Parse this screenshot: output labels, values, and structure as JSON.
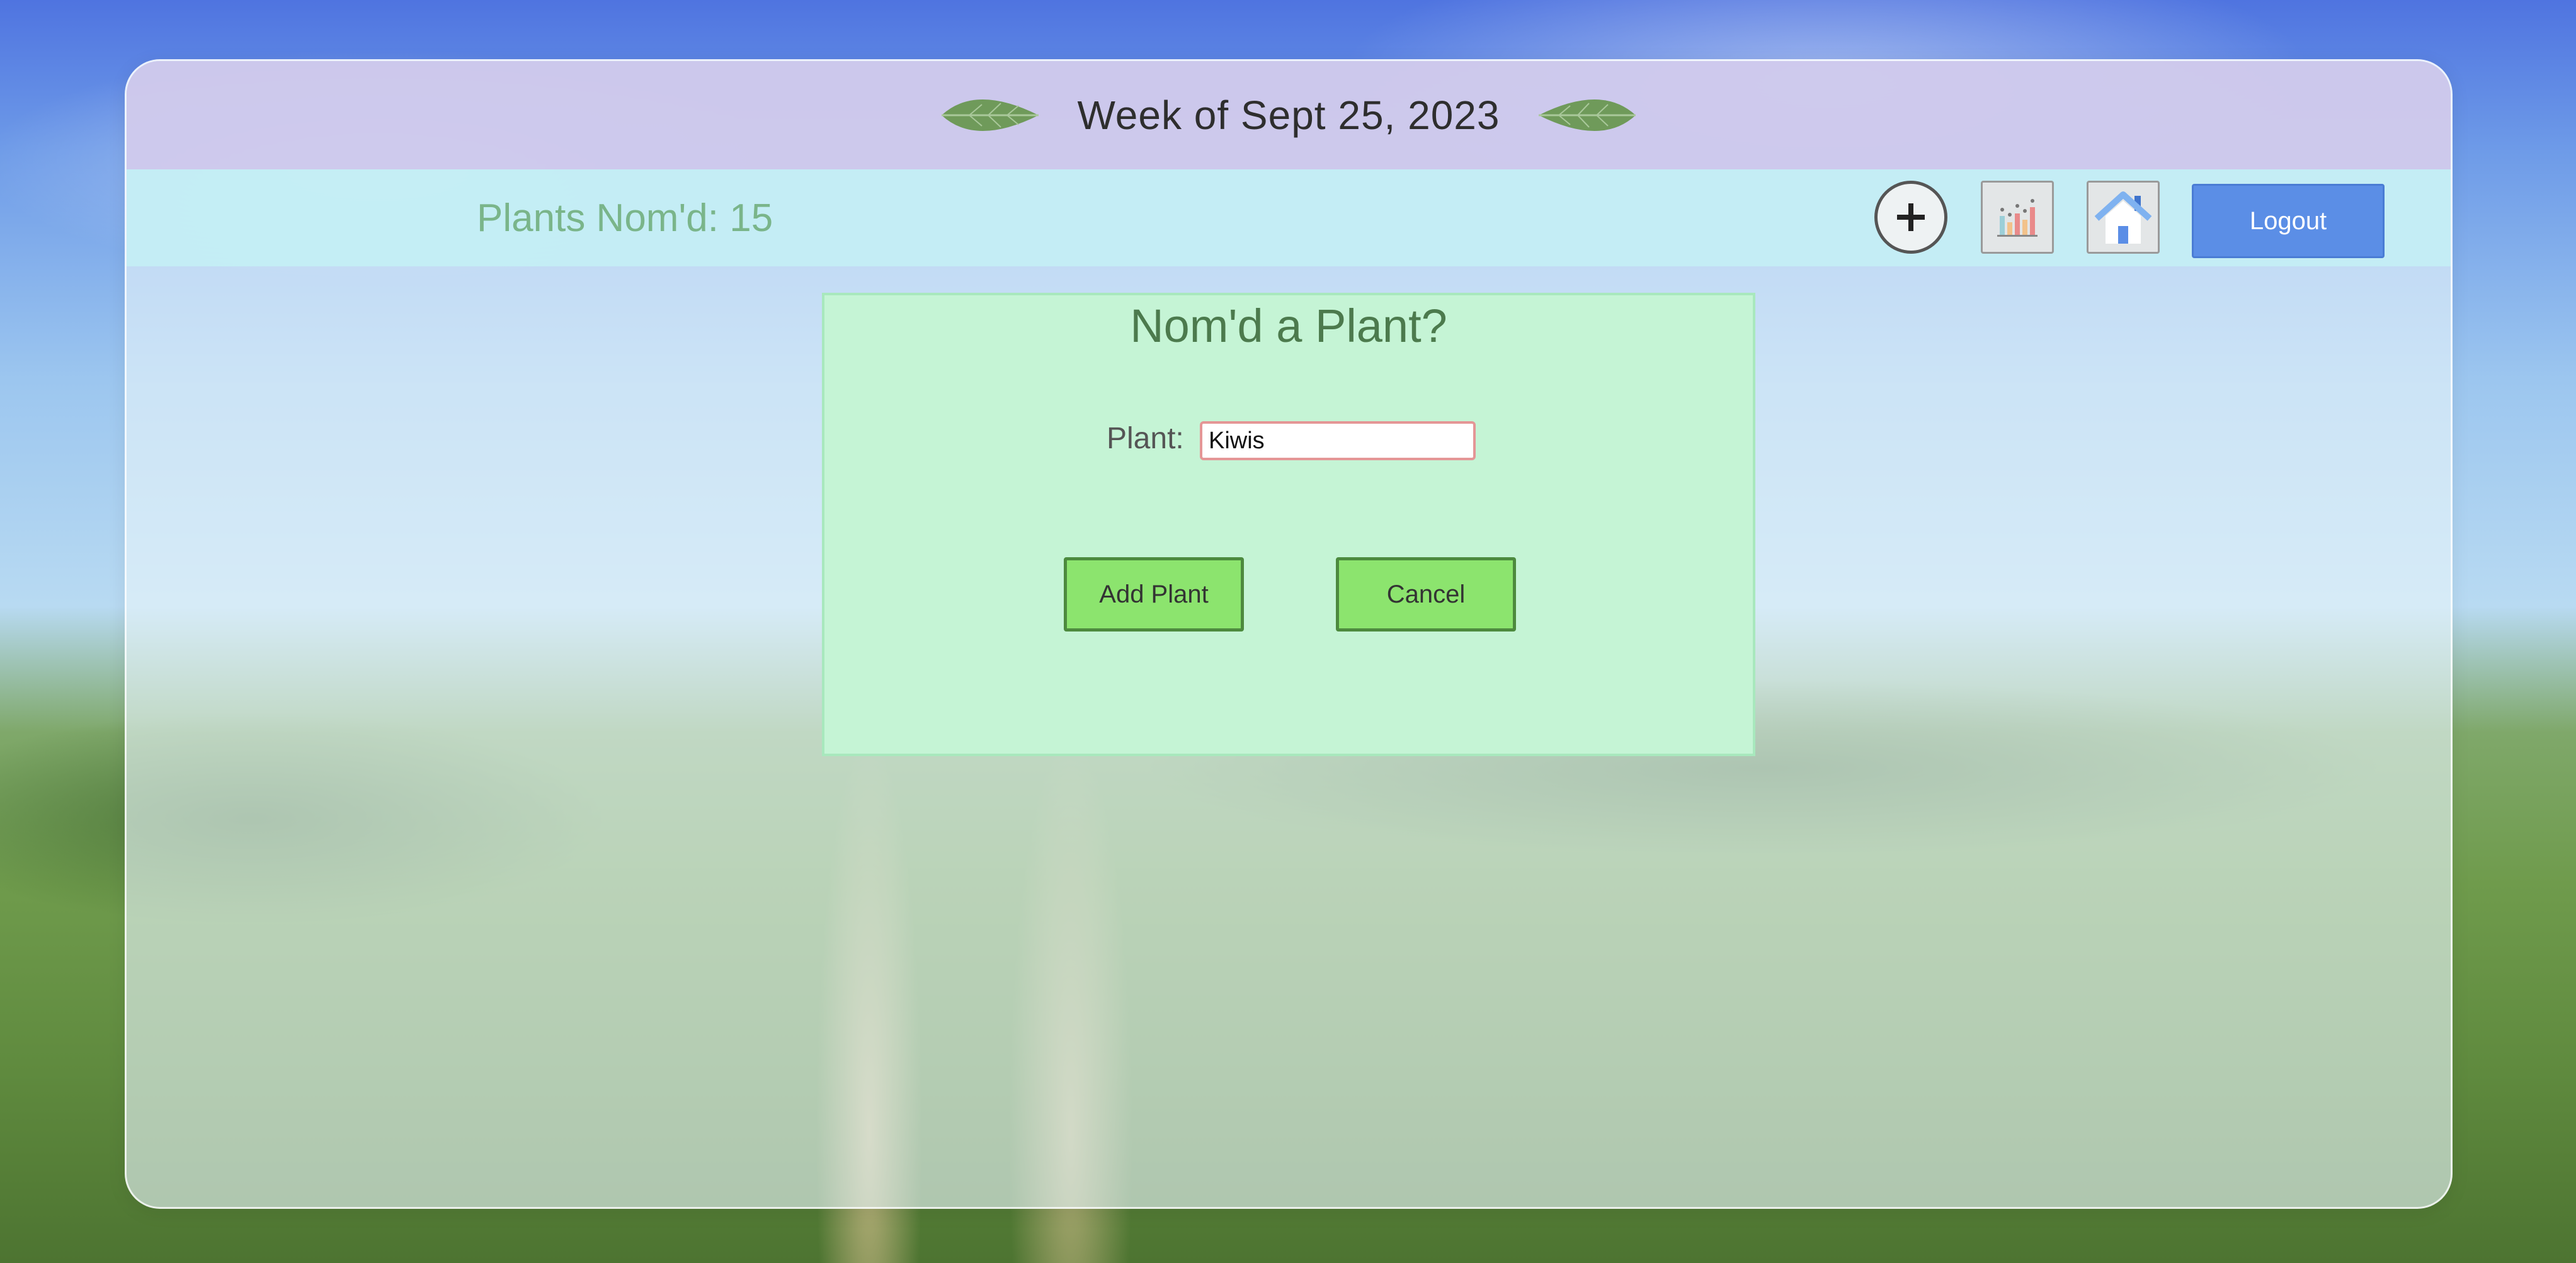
{
  "header": {
    "title": "Week of Sept 25, 2023",
    "left_icon": "leaf-icon",
    "right_icon": "leaf-icon"
  },
  "navbar": {
    "plant_count_text": "Plants Nom'd: 15",
    "add_icon": "plus-icon",
    "stats_icon": "bar-chart-icon",
    "home_icon": "home-icon",
    "logout_label": "Logout"
  },
  "dialog": {
    "title": "Nom'd a Plant?",
    "plant_label": "Plant:",
    "plant_value": "Kiwis",
    "add_label": "Add Plant",
    "cancel_label": "Cancel"
  },
  "colors": {
    "title_bar": "#cec8ec",
    "nav_bar": "#c4eef4",
    "dialog_bg": "#c5f4d5",
    "action_button": "#8ce46e",
    "logout_button": "#5b8ee6",
    "count_text": "#7ab58a"
  }
}
